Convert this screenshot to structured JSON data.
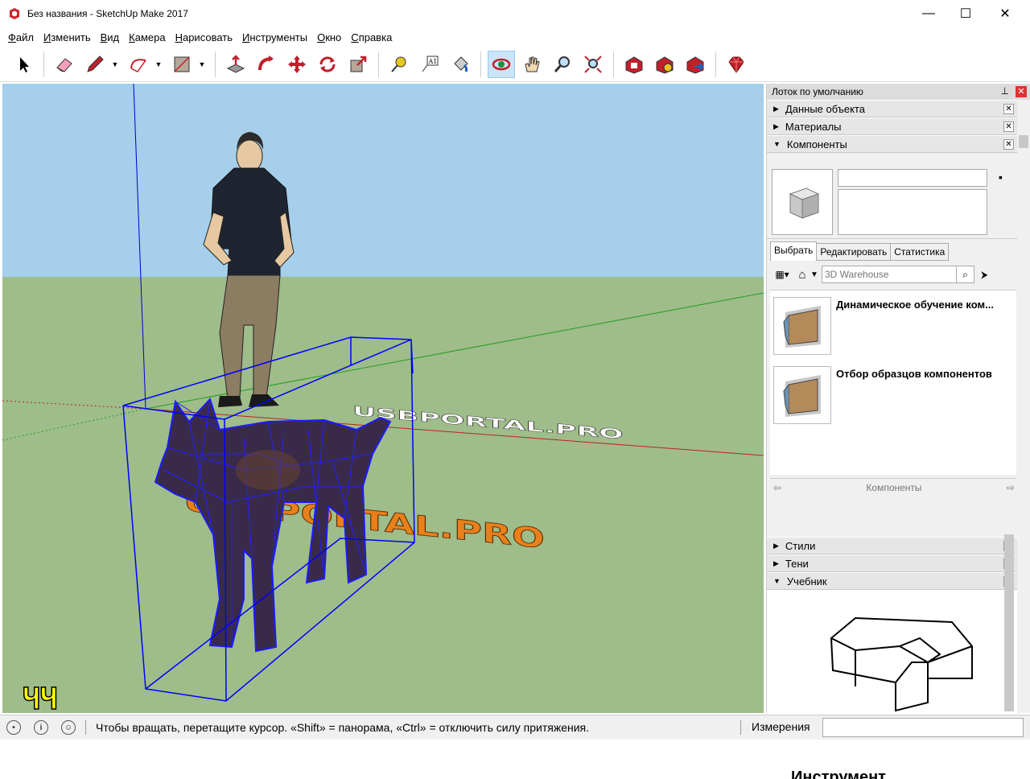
{
  "window": {
    "title": "Без названия - SketchUp Make 2017",
    "minimize": "—",
    "maximize": "☐",
    "close": "✕"
  },
  "menu": [
    "Файл",
    "Изменить",
    "Вид",
    "Камера",
    "Нарисовать",
    "Инструменты",
    "Окно",
    "Справка"
  ],
  "toolbar": {
    "tools": [
      "select-icon",
      "eraser-icon",
      "pencil-icon",
      "arc-icon",
      "rectangle-icon",
      "push-pull-icon",
      "follow-me-icon",
      "move-icon",
      "rotate-icon",
      "scale-icon",
      "tape-measure-icon",
      "text-icon",
      "paint-bucket-icon",
      "orbit-icon",
      "pan-icon",
      "zoom-icon",
      "zoom-extents-icon",
      "warehouse-icon",
      "extension-icon",
      "share-icon",
      "ruby-icon"
    ],
    "active": "orbit-icon"
  },
  "viewport": {
    "watermark_text": "USBPORTAL.PRO",
    "corner_logo": "ЧЧ",
    "colors": {
      "sky": "#a5cfeb",
      "ground": "#9fbc8b",
      "selection": "#0000ff"
    }
  },
  "tray": {
    "title": "Лоток по умолчанию",
    "panels": [
      {
        "label": "Данные объекта",
        "expanded": false
      },
      {
        "label": "Материалы",
        "expanded": false
      },
      {
        "label": "Компоненты",
        "expanded": true
      }
    ],
    "components": {
      "tabs": [
        "Выбрать",
        "Редактировать",
        "Статистика"
      ],
      "search_placeholder": "3D Warehouse",
      "items": [
        {
          "label": "Динамическое обучение ком..."
        },
        {
          "label": "Отбор образцов компонентов"
        }
      ],
      "nav_label": "Компоненты"
    },
    "lower_panels": [
      {
        "label": "Стили",
        "expanded": false
      },
      {
        "label": "Тени",
        "expanded": false
      },
      {
        "label": "Учебник",
        "expanded": true
      }
    ],
    "tutorial_heading": "Инструмент"
  },
  "status": {
    "hint": "Чтобы вращать, перетащите курсор. «Shift» = панорама, «Ctrl» = отключить силу притяжения.",
    "measure_label": "Измерения",
    "measure_value": ""
  }
}
